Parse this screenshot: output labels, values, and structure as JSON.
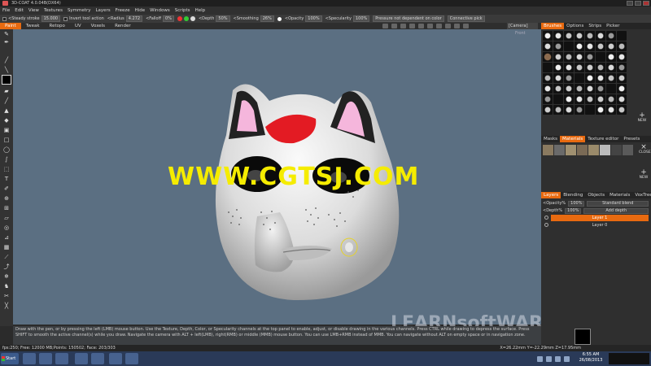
{
  "window": {
    "title": "3D-COAT 4.0.04B(DX64)"
  },
  "menu": [
    "File",
    "Edit",
    "View",
    "Textures",
    "Symmetry",
    "Layers",
    "Freeze",
    "Hide",
    "Windows",
    "Scripts",
    "Help"
  ],
  "options": {
    "steady_stroke": "<Steady stroke",
    "steady_value": "15.000",
    "invert_tool_action": "Invert tool action",
    "radius_label": "<Radius",
    "radius_value": "4.272",
    "falloff_label": "<Falloff",
    "falloff_value": "0%",
    "depth_label": "<Depth",
    "depth_value": "50%",
    "smoothing_label": "<Smoothing",
    "smoothing_value": "26%",
    "opacity_label": "<Opacity",
    "opacity_value": "100%",
    "specularity_label": "<Specularity",
    "specularity_value": "100%",
    "pressure": "Pressure not dependent on color",
    "connective": "Connective pick"
  },
  "room_tabs": [
    "Paint",
    "Tweak",
    "Retopo",
    "UV",
    "Voxels",
    "Render"
  ],
  "active_room": "Paint",
  "camera": "[Camera]",
  "viewport": {
    "view_label": "Front",
    "watermark": "WWW.CGTSJ.COM",
    "brand_watermark": "LEARNsoftWARE.com"
  },
  "hint": "Draw with the pen, or by pressing the left (LMB) mouse button. Use the Texture, Depth, Color, or Specularity channels at the top panel to enable, adjust, or disable drawing in the various channels. Press CTRL while drawing to depress the surface. Press SHIFT to smooth the active channel(s) while you draw. Navigate the camera with ALT + left(LMB), right(RMB) or middle (MMB) mouse button. You can use LMB+RMB instead of MMB. You can navigate without ALT on empty space or in navigation zone.",
  "status": {
    "left": "fps:250;   Free: 12000 MB;Points: 150502; Face: 203/303",
    "right": "X=26.22mm  Y=-22.29mm  Z=17.95mm"
  },
  "panels": {
    "brushes_tabs": [
      "Brushes",
      "Options",
      "Strips",
      "Picker"
    ],
    "materials_tabs": [
      "Masks",
      "Materials",
      "Texture editor",
      "Presets"
    ],
    "layers_tabs": [
      "Layers",
      "Blending",
      "Objects",
      "Materials",
      "VoxTree"
    ],
    "new_label": "NEW",
    "close_label": "CLOSE",
    "opacity_label": "<Opacity%",
    "opacity_value": "100%",
    "blend_mode": "Standard blend",
    "depth_label": "<Depth%",
    "depth_value": "100%",
    "depth_mode": "Add depth",
    "layers": [
      "Layer 1",
      "Layer 0"
    ]
  },
  "taskbar": {
    "start": "Start",
    "time": "6:55 AM",
    "date": "26/08/2013"
  },
  "colors": {
    "accent": "#e86a10",
    "viewport_bg": "#5b6f82",
    "watermark": "#f5ec00"
  }
}
